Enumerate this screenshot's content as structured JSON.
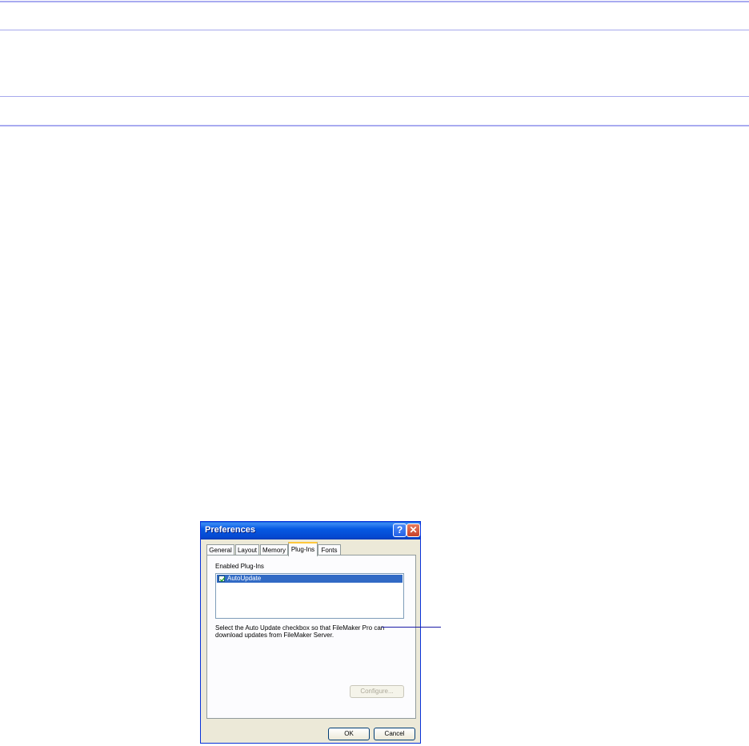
{
  "dialog": {
    "title": "Preferences",
    "help_glyph": "?",
    "close_glyph": "✕",
    "tabs": [
      {
        "label": "General"
      },
      {
        "label": "Layout"
      },
      {
        "label": "Memory"
      },
      {
        "label": "Plug-Ins"
      },
      {
        "label": "Fonts"
      }
    ],
    "selected_tab": "Plug-Ins",
    "enabled_plugins_label": "Enabled Plug-Ins",
    "plugins": [
      {
        "name": "AutoUpdate",
        "checked": true
      }
    ],
    "description_lines": [
      "Select the Auto Update checkbox so that FileMaker Pro can",
      "download updates from FileMaker Server."
    ],
    "configure_label": "Configure...",
    "ok_label": "OK",
    "cancel_label": "Cancel"
  },
  "colors": {
    "titlebar": "#0554d6",
    "selection": "#316ac5",
    "doc_rule": "#a7a9ec",
    "callout": "#1a1aa6"
  }
}
